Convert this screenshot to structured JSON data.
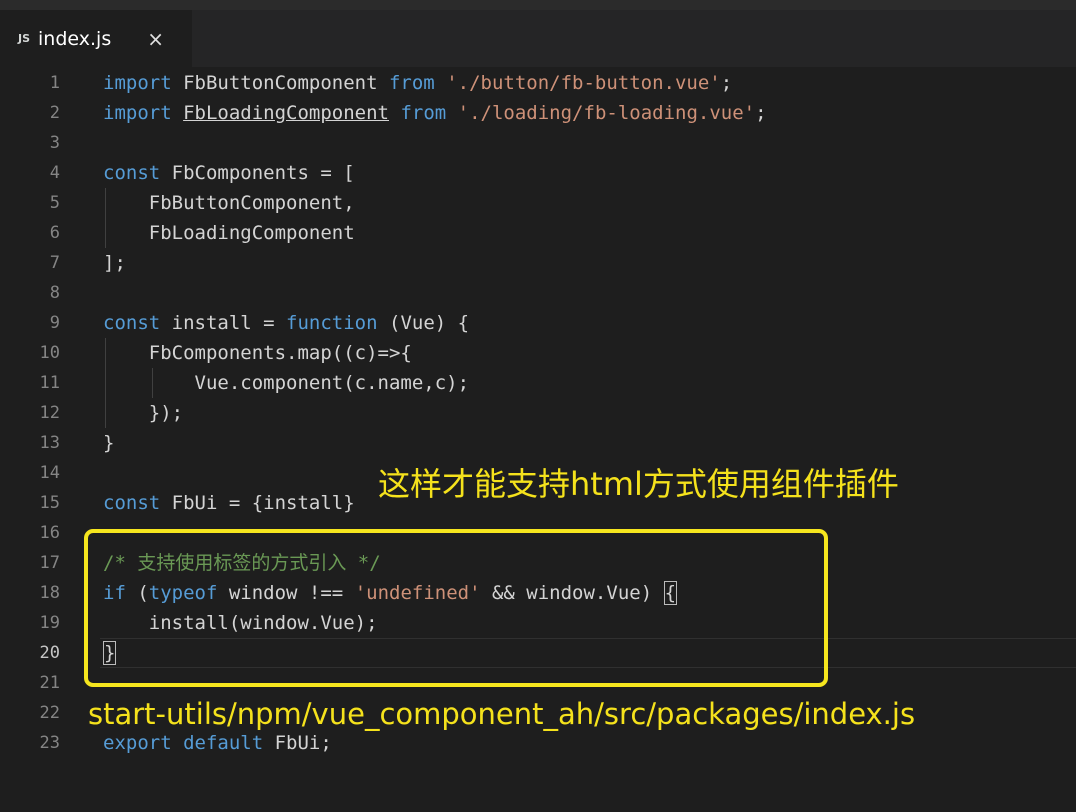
{
  "tab": {
    "icon": "JS",
    "label": "index.js",
    "close": "×"
  },
  "editor": {
    "active_line": 20,
    "lines": [
      {
        "n": "1",
        "tokens": [
          [
            "kw",
            "import"
          ],
          [
            "p",
            " FbButtonComponent "
          ],
          [
            "kw",
            "from"
          ],
          [
            "p",
            " "
          ],
          [
            "str",
            "'./button/fb-button.vue'"
          ],
          [
            "p",
            ";"
          ]
        ]
      },
      {
        "n": "2",
        "tokens": [
          [
            "kw",
            "import"
          ],
          [
            "p",
            " "
          ],
          [
            "ul",
            "FbLoadingComponent"
          ],
          [
            "p",
            " "
          ],
          [
            "kw",
            "from"
          ],
          [
            "p",
            " "
          ],
          [
            "str",
            "'./loading/fb-loading.vue'"
          ],
          [
            "p",
            ";"
          ]
        ]
      },
      {
        "n": "3",
        "tokens": []
      },
      {
        "n": "4",
        "tokens": [
          [
            "kw",
            "const"
          ],
          [
            "p",
            " FbComponents = ["
          ]
        ]
      },
      {
        "n": "5",
        "tokens": [
          [
            "p",
            "    FbButtonComponent,"
          ]
        ]
      },
      {
        "n": "6",
        "tokens": [
          [
            "p",
            "    FbLoadingComponent"
          ]
        ]
      },
      {
        "n": "7",
        "tokens": [
          [
            "p",
            "];"
          ]
        ]
      },
      {
        "n": "8",
        "tokens": []
      },
      {
        "n": "9",
        "tokens": [
          [
            "kw",
            "const"
          ],
          [
            "p",
            " install = "
          ],
          [
            "kw",
            "function"
          ],
          [
            "p",
            " (Vue) {"
          ]
        ]
      },
      {
        "n": "10",
        "tokens": [
          [
            "p",
            "    FbComponents.map((c)=>{"
          ]
        ]
      },
      {
        "n": "11",
        "tokens": [
          [
            "p",
            "        Vue.component(c.name,c);"
          ]
        ]
      },
      {
        "n": "12",
        "tokens": [
          [
            "p",
            "    });"
          ]
        ]
      },
      {
        "n": "13",
        "tokens": [
          [
            "p",
            "}"
          ]
        ]
      },
      {
        "n": "14",
        "tokens": []
      },
      {
        "n": "15",
        "tokens": [
          [
            "kw",
            "const"
          ],
          [
            "p",
            " FbUi = {install}"
          ]
        ]
      },
      {
        "n": "16",
        "tokens": []
      },
      {
        "n": "17",
        "tokens": [
          [
            "cm",
            "/* 支持使用标签的方式引入 */"
          ]
        ]
      },
      {
        "n": "18",
        "tokens": [
          [
            "kw",
            "if"
          ],
          [
            "p",
            " ("
          ],
          [
            "kw",
            "typeof"
          ],
          [
            "p",
            " window !== "
          ],
          [
            "str",
            "'undefined'"
          ],
          [
            "p",
            " && window.Vue) "
          ],
          [
            "bx",
            "{"
          ]
        ]
      },
      {
        "n": "19",
        "tokens": [
          [
            "p",
            "    install(window.Vue);"
          ]
        ]
      },
      {
        "n": "20",
        "tokens": [
          [
            "bx",
            "}"
          ]
        ]
      },
      {
        "n": "21",
        "tokens": []
      },
      {
        "n": "22",
        "tokens": []
      },
      {
        "n": "23",
        "tokens": [
          [
            "kw",
            "export"
          ],
          [
            "p",
            " "
          ],
          [
            "kw",
            "default"
          ],
          [
            "p",
            " FbUi;"
          ]
        ]
      }
    ]
  },
  "annotations": {
    "chinese_note": "这样才能支持html方式使用组件插件",
    "path_note": "start-utils/npm/vue_component_ah/src/packages/index.js"
  },
  "colors": {
    "background": "#1e1e1e",
    "annotation_yellow": "#f6e61e",
    "keyword": "#569cd6",
    "string": "#ce9178",
    "comment": "#6a9955"
  }
}
